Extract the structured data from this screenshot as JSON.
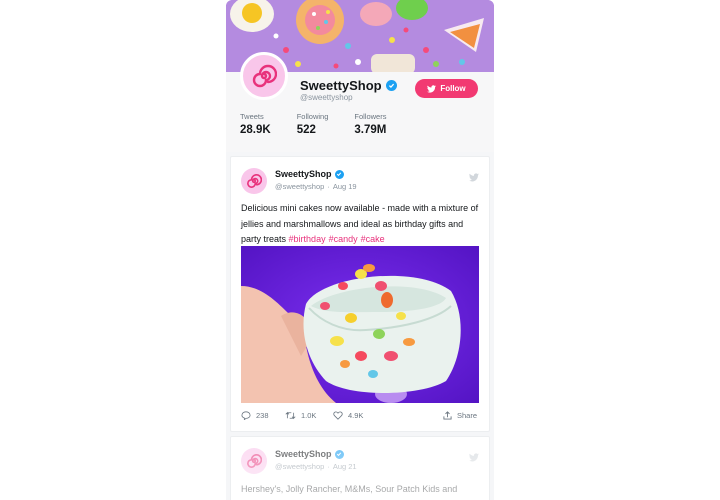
{
  "profile": {
    "name": "SweettyShop",
    "handle": "@sweettyshop",
    "follow_label": "Follow",
    "stats": [
      {
        "label": "Tweets",
        "value": "28.9K"
      },
      {
        "label": "Following",
        "value": "522"
      },
      {
        "label": "Followers",
        "value": "3.79M"
      }
    ]
  },
  "tweets": [
    {
      "name": "SweettyShop",
      "handle": "@sweettyshop",
      "date": "Aug 19",
      "text": "Delicious mini cakes now available - made with a mixture of jellies and marshmallows and ideal as birthday gifts and party treats",
      "hashtags": [
        "#birthday",
        "#candy",
        "#cake"
      ],
      "replies": "238",
      "retweets": "1.0K",
      "likes": "4.9K",
      "share_label": "Share"
    },
    {
      "name": "SweettyShop",
      "handle": "@sweettyshop",
      "date": "Aug 21",
      "text": "Hershey's, Jolly Rancher, M&Ms, Sour Patch Kids and"
    }
  ],
  "colors": {
    "accent": "#f23972",
    "hashtag": "#e8327c",
    "verified": "#1da1f2",
    "cover": "#b48be0",
    "image_bg": "#6a1fd6"
  },
  "icons": [
    "verified-icon",
    "twitter-bird-icon",
    "reply-icon",
    "retweet-icon",
    "heart-icon",
    "share-icon"
  ]
}
